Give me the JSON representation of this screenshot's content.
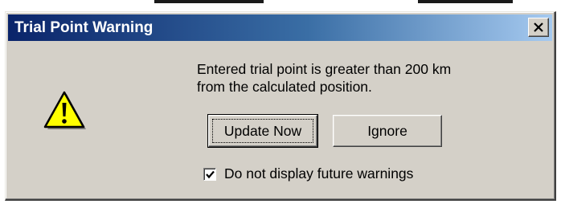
{
  "window": {
    "title": "Trial Point Warning",
    "close_label": "X"
  },
  "icon": {
    "name": "warning-icon",
    "color": "#ffff00"
  },
  "message": {
    "line1": "Entered trial point is greater than 200 km",
    "line2": "from the calculated position."
  },
  "buttons": {
    "update_now": "Update Now",
    "ignore": "Ignore"
  },
  "checkbox": {
    "label": "Do not display future warnings",
    "checked": true
  },
  "colors": {
    "titlebar_start": "#0a246a",
    "titlebar_end": "#a6caf0",
    "dialog_face": "#d4d0c8"
  }
}
